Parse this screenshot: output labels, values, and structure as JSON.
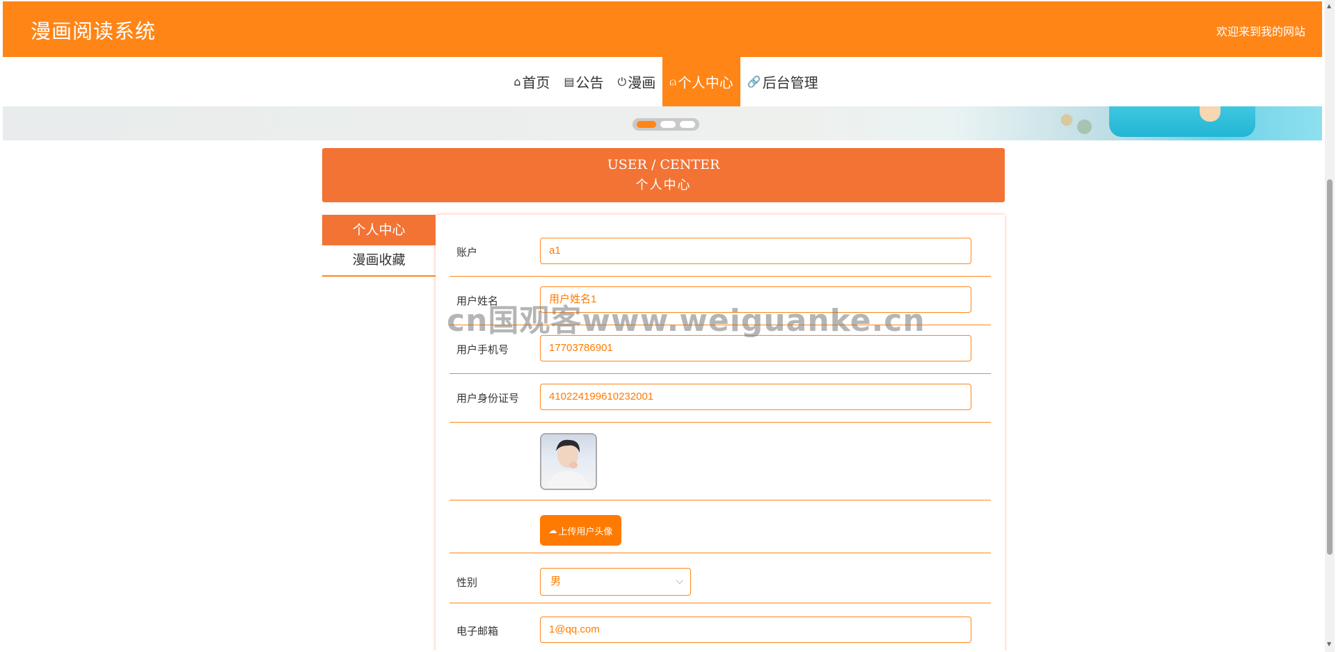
{
  "header": {
    "title": "漫画阅读系统",
    "welcome": "欢迎来到我的网站"
  },
  "nav": {
    "items": [
      {
        "icon": "⌂",
        "label": "首页",
        "active": false
      },
      {
        "icon": "▤",
        "label": "公告",
        "active": false
      },
      {
        "icon": "⏻",
        "label": "漫画",
        "active": false
      },
      {
        "icon": "⍝",
        "label": "个人中心",
        "active": true
      },
      {
        "icon": "🔗",
        "label": "后台管理",
        "active": false
      }
    ]
  },
  "carousel": {
    "active_index": 0,
    "count": 3
  },
  "section": {
    "title_en": "USER / CENTER",
    "title_cn": "个人中心"
  },
  "side_menu": {
    "items": [
      {
        "label": "个人中心",
        "active": true
      },
      {
        "label": "漫画收藏",
        "active": false
      }
    ]
  },
  "form": {
    "account": {
      "label": "账户",
      "value": "a1"
    },
    "name": {
      "label": "用户姓名",
      "value": "用户姓名1"
    },
    "phone": {
      "label": "用户手机号",
      "value": "17703786901"
    },
    "id_card": {
      "label": "用户身份证号",
      "value": "410224199610232001"
    },
    "upload_button": "上传用户头像",
    "gender": {
      "label": "性别",
      "value": "男"
    },
    "email": {
      "label": "电子邮箱",
      "value": "1@qq.com"
    }
  },
  "watermark": "cn国观客www.weiguanke.cn",
  "colors": {
    "primary": "#ff8516",
    "section": "#f37335",
    "text_orange": "#ff7a00"
  }
}
